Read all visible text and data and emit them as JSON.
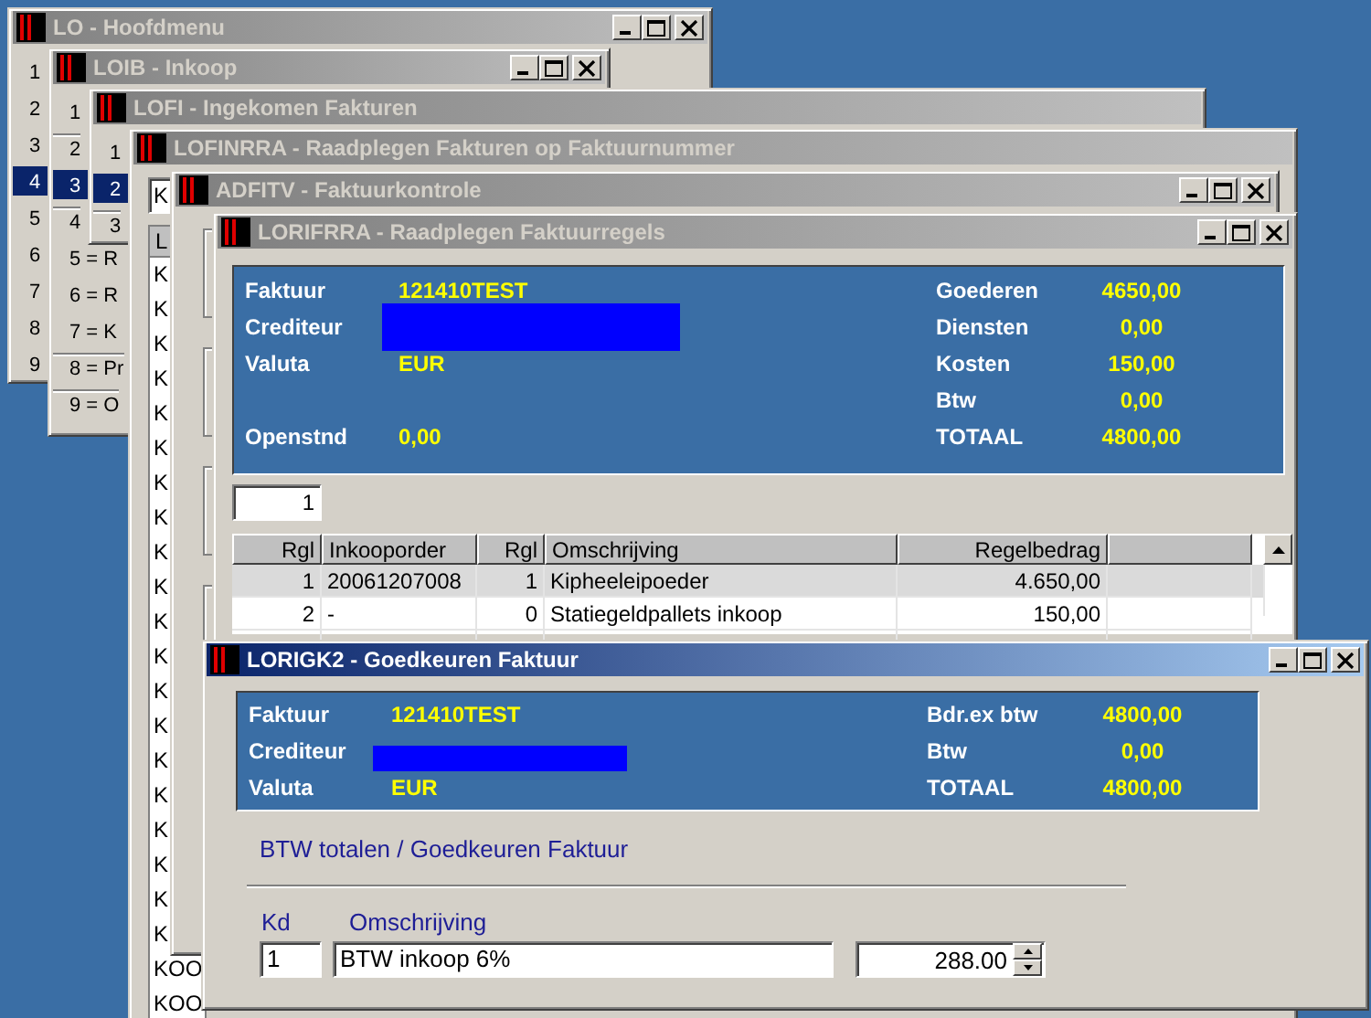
{
  "windows": [
    {
      "kind": "menu",
      "title": "LO - Hoofdmenu",
      "active": false,
      "controls": true,
      "items": [
        {
          "label": "1",
          "selected": false,
          "divider_above": false
        },
        {
          "label": "2",
          "selected": false,
          "divider_above": false
        },
        {
          "label": "3",
          "selected": false,
          "divider_above": false
        },
        {
          "label": "4",
          "selected": true,
          "divider_above": false
        },
        {
          "label": "5",
          "selected": false,
          "divider_above": false
        },
        {
          "label": "6",
          "selected": false,
          "divider_above": false
        },
        {
          "label": "7",
          "selected": false,
          "divider_above": false
        },
        {
          "label": "8",
          "selected": false,
          "divider_above": false
        },
        {
          "label": "9",
          "selected": false,
          "divider_above": false
        }
      ]
    },
    {
      "kind": "menu",
      "title": "LOIB - Inkoop",
      "active": false,
      "controls": true,
      "items": [
        {
          "label": "1",
          "selected": false,
          "divider_above": false
        },
        {
          "label": "2",
          "selected": false,
          "divider_above": true
        },
        {
          "label": "3",
          "selected": true,
          "divider_above": false
        },
        {
          "label": "4",
          "selected": false,
          "divider_above": true
        },
        {
          "label": "5 = R",
          "selected": false,
          "divider_above": false
        },
        {
          "label": "6 = R",
          "selected": false,
          "divider_above": false
        },
        {
          "label": "7 = K",
          "selected": false,
          "divider_above": false
        },
        {
          "label": "8 = Pr",
          "selected": false,
          "divider_above": true
        },
        {
          "label": "9 = O",
          "selected": false,
          "divider_above": true
        }
      ]
    },
    {
      "kind": "menu",
      "title": "LOFI - Ingekomen Fakturen",
      "active": false,
      "controls": false,
      "items": [
        {
          "label": "1",
          "selected": false,
          "divider_above": false
        },
        {
          "label": "2",
          "selected": true,
          "divider_above": false
        },
        {
          "label": "3",
          "selected": false,
          "divider_above": true
        }
      ]
    },
    {
      "kind": "list",
      "title": "LOFINRRA - Raadplegen Fakturen op Faktuurnummer",
      "active": false,
      "controls": false,
      "field": "K",
      "header": "L",
      "rows": [
        "K",
        "K",
        "K",
        "K",
        "K",
        "K",
        "K",
        "K",
        "K",
        "K",
        "K",
        "K",
        "K",
        "K",
        "K",
        "K",
        "K",
        "K",
        "K",
        "K",
        "KOO",
        "KOO"
      ]
    },
    {
      "kind": "groups",
      "title": "ADFITV - Faktuurkontrole",
      "active": false,
      "controls": true
    },
    {
      "kind": "invoice_lines",
      "title": "LORIFRRA - Raadplegen Faktuurregels",
      "active": false,
      "controls": true,
      "summary": {
        "left": [
          {
            "label": "Faktuur",
            "value": "121410TEST",
            "redacted": false
          },
          {
            "label": "Crediteur",
            "redacted": true
          },
          {
            "label": "Valuta",
            "value": "EUR",
            "redacted": false
          },
          {
            "label": "Openstnd",
            "value": "0,00",
            "redacted": false
          }
        ],
        "right": [
          {
            "label": "Goederen",
            "value": "4650,00"
          },
          {
            "label": "Diensten",
            "value": "0,00"
          },
          {
            "label": "Kosten",
            "value": "150,00"
          },
          {
            "label": "Btw",
            "value": "0,00"
          },
          {
            "label": "TOTAAL",
            "value": "4800,00"
          }
        ]
      },
      "page": "1",
      "table": {
        "columns": [
          "Rgl",
          "Inkooporder",
          "Rgl",
          "Omschrijving",
          "Regelbedrag"
        ],
        "rows": [
          {
            "cells": [
              "1",
              "20061207008",
              "1",
              "Kipheeleipoeder",
              "4.650,00"
            ],
            "selected": true
          },
          {
            "cells": [
              "2",
              "-",
              "0",
              "Statiegeldpallets inkoop",
              "150,00"
            ],
            "selected": false
          }
        ]
      }
    },
    {
      "kind": "approval",
      "title": "LORIGK2 - Goedkeuren Faktuur",
      "active": true,
      "controls": true,
      "summary": {
        "left": [
          {
            "label": "Faktuur",
            "value": "121410TEST",
            "redacted": false
          },
          {
            "label": "Crediteur",
            "redacted": true
          },
          {
            "label": "Valuta",
            "value": "EUR",
            "redacted": false
          }
        ],
        "right": [
          {
            "label": "Bdr.ex btw",
            "value": "4800,00"
          },
          {
            "label": "Btw",
            "value": "0,00"
          },
          {
            "label": "TOTAAL",
            "value": "4800,00"
          }
        ]
      },
      "heading": "BTW totalen / Goedkeuren Faktuur",
      "labels": [
        "Kd",
        "Omschrijving"
      ],
      "fields": {
        "code": "1",
        "description": "BTW inkoop 6%",
        "amount": "288.00"
      }
    }
  ]
}
